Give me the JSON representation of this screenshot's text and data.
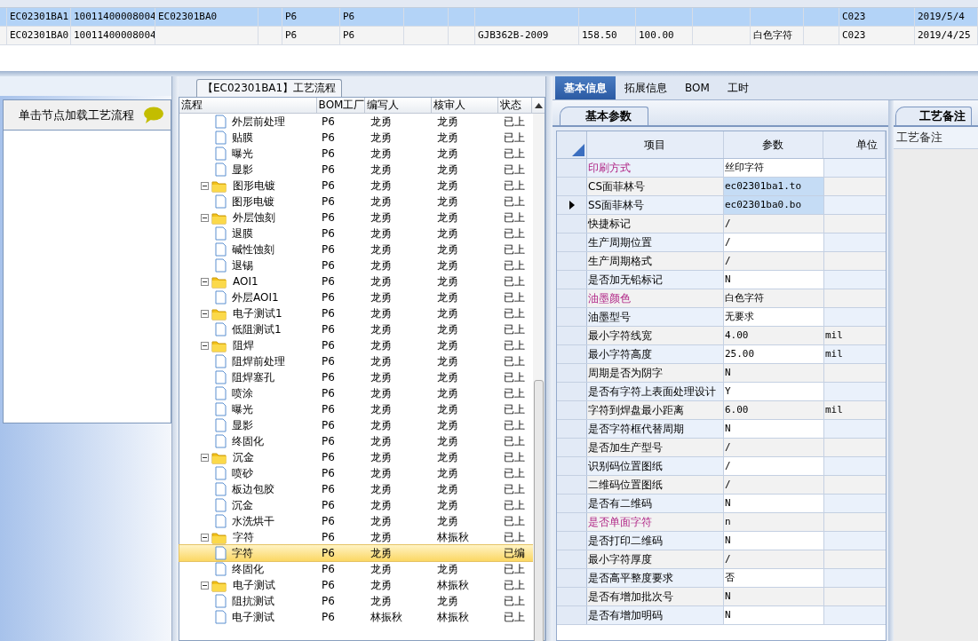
{
  "top_table": {
    "rows": [
      {
        "selected": true,
        "column_1": "EC02301BA1",
        "column_2": "10011400008004",
        "column_3": "EC02301BA0",
        "column_5": "P6",
        "column_6": "P6",
        "column_15": "C023",
        "column_16": "2019/5/4"
      },
      {
        "selected": false,
        "column_1": "EC02301BA0",
        "column_2": "10011400008004",
        "column_5": "P6",
        "column_6": "P6",
        "column_9": "GJB362B-2009",
        "column_10": "158.50",
        "column_11": "100.00",
        "column_13": "白色字符",
        "column_15": "C023",
        "column_16": "2019/4/25"
      }
    ]
  },
  "left_panel": {
    "hint": "单击节点加载工艺流程"
  },
  "flow_panel": {
    "title": "【EC02301BA1】工艺流程",
    "columns": [
      "流程",
      "BOM工厂",
      "编写人",
      "核审人",
      "状态"
    ],
    "tree": [
      {
        "children": [
          {
            "name": "外层前处理",
            "bom": "P6",
            "writer": "龙勇",
            "reviewer": "龙勇",
            "status": "已上",
            "selected": false
          },
          {
            "name": "贴膜",
            "bom": "P6",
            "writer": "龙勇",
            "reviewer": "龙勇",
            "status": "已上",
            "selected": false
          },
          {
            "name": "曝光",
            "bom": "P6",
            "writer": "龙勇",
            "reviewer": "龙勇",
            "status": "已上",
            "selected": false
          },
          {
            "name": "显影",
            "bom": "P6",
            "writer": "龙勇",
            "reviewer": "龙勇",
            "status": "已上",
            "selected": false
          }
        ]
      },
      {
        "name": "图形电镀",
        "bom": "P6",
        "writer": "龙勇",
        "reviewer": "龙勇",
        "status": "已上",
        "selected": false,
        "expanded": true,
        "children": [
          {
            "name": "图形电镀",
            "bom": "P6",
            "writer": "龙勇",
            "reviewer": "龙勇",
            "status": "已上",
            "selected": false
          }
        ]
      },
      {
        "name": "外层蚀刻",
        "bom": "P6",
        "writer": "龙勇",
        "reviewer": "龙勇",
        "status": "已上",
        "selected": false,
        "expanded": true,
        "children": [
          {
            "name": "退膜",
            "bom": "P6",
            "writer": "龙勇",
            "reviewer": "龙勇",
            "status": "已上",
            "selected": false
          },
          {
            "name": "碱性蚀刻",
            "bom": "P6",
            "writer": "龙勇",
            "reviewer": "龙勇",
            "status": "已上",
            "selected": false
          },
          {
            "name": "退锡",
            "bom": "P6",
            "writer": "龙勇",
            "reviewer": "龙勇",
            "status": "已上",
            "selected": false
          }
        ]
      },
      {
        "name": "AOI1",
        "bom": "P6",
        "writer": "龙勇",
        "reviewer": "龙勇",
        "status": "已上",
        "selected": false,
        "expanded": true,
        "children": [
          {
            "name": "外层AOI1",
            "bom": "P6",
            "writer": "龙勇",
            "reviewer": "龙勇",
            "status": "已上",
            "selected": false
          }
        ]
      },
      {
        "name": "电子测试1",
        "bom": "P6",
        "writer": "龙勇",
        "reviewer": "龙勇",
        "status": "已上",
        "selected": false,
        "expanded": true,
        "children": [
          {
            "name": "低阻测试1",
            "bom": "P6",
            "writer": "龙勇",
            "reviewer": "龙勇",
            "status": "已上",
            "selected": false
          }
        ]
      },
      {
        "name": "阻焊",
        "bom": "P6",
        "writer": "龙勇",
        "reviewer": "龙勇",
        "status": "已上",
        "selected": false,
        "expanded": true,
        "children": [
          {
            "name": "阻焊前处理",
            "bom": "P6",
            "writer": "龙勇",
            "reviewer": "龙勇",
            "status": "已上",
            "selected": false
          },
          {
            "name": "阻焊塞孔",
            "bom": "P6",
            "writer": "龙勇",
            "reviewer": "龙勇",
            "status": "已上",
            "selected": false
          },
          {
            "name": "喷涂",
            "bom": "P6",
            "writer": "龙勇",
            "reviewer": "龙勇",
            "status": "已上",
            "selected": false
          },
          {
            "name": "曝光",
            "bom": "P6",
            "writer": "龙勇",
            "reviewer": "龙勇",
            "status": "已上",
            "selected": false
          },
          {
            "name": "显影",
            "bom": "P6",
            "writer": "龙勇",
            "reviewer": "龙勇",
            "status": "已上",
            "selected": false
          },
          {
            "name": "终固化",
            "bom": "P6",
            "writer": "龙勇",
            "reviewer": "龙勇",
            "status": "已上",
            "selected": false
          }
        ]
      },
      {
        "name": "沉金",
        "bom": "P6",
        "writer": "龙勇",
        "reviewer": "龙勇",
        "status": "已上",
        "selected": false,
        "expanded": true,
        "children": [
          {
            "name": "喷砂",
            "bom": "P6",
            "writer": "龙勇",
            "reviewer": "龙勇",
            "status": "已上",
            "selected": false
          },
          {
            "name": "板边包胶",
            "bom": "P6",
            "writer": "龙勇",
            "reviewer": "龙勇",
            "status": "已上",
            "selected": false
          },
          {
            "name": "沉金",
            "bom": "P6",
            "writer": "龙勇",
            "reviewer": "龙勇",
            "status": "已上",
            "selected": false
          },
          {
            "name": "水洗烘干",
            "bom": "P6",
            "writer": "龙勇",
            "reviewer": "龙勇",
            "status": "已上",
            "selected": false
          }
        ]
      },
      {
        "name": "字符",
        "bom": "P6",
        "writer": "龙勇",
        "reviewer": "林振秋",
        "status": "已上",
        "selected": false,
        "expanded": true,
        "children": [
          {
            "name": "字符",
            "bom": "P6",
            "writer": "龙勇",
            "status": "已编",
            "selected": true
          },
          {
            "name": "终固化",
            "bom": "P6",
            "writer": "龙勇",
            "reviewer": "龙勇",
            "status": "已上",
            "selected": false
          }
        ]
      },
      {
        "name": "电子测试",
        "bom": "P6",
        "writer": "龙勇",
        "reviewer": "林振秋",
        "status": "已上",
        "selected": false,
        "expanded": true,
        "children": [
          {
            "name": "阻抗测试",
            "bom": "P6",
            "writer": "龙勇",
            "reviewer": "龙勇",
            "status": "已上",
            "selected": false
          },
          {
            "name": "电子测试",
            "bom": "P6",
            "writer": "林振秋",
            "reviewer": "林振秋",
            "status": "已上",
            "selected": false
          }
        ]
      }
    ]
  },
  "info_panel": {
    "tabs": [
      {
        "label": "基本信息",
        "selected": true
      },
      {
        "label": "拓展信息",
        "selected": false
      },
      {
        "label": "BOM",
        "selected": false
      },
      {
        "label": "工时",
        "selected": false
      }
    ],
    "sub_tab": "基本参数",
    "columns": [
      "项目",
      "参数",
      "单位"
    ],
    "rows": [
      {
        "item": "印刷方式",
        "value": "丝印字符",
        "flagged": true,
        "selected": false,
        "current": false
      },
      {
        "item": "CS面菲林号",
        "value": "ec02301ba1.to",
        "flagged": false,
        "selected": true,
        "current": false
      },
      {
        "item": "SS面菲林号",
        "value": "ec02301ba0.bo",
        "flagged": false,
        "selected": true,
        "current": true
      },
      {
        "item": "快捷标记",
        "value": "/",
        "flagged": false,
        "selected": false,
        "current": false
      },
      {
        "item": "生产周期位置",
        "value": "/",
        "flagged": false,
        "selected": false,
        "current": false
      },
      {
        "item": "生产周期格式",
        "value": "/",
        "flagged": false,
        "selected": false,
        "current": false
      },
      {
        "item": "是否加无铅标记",
        "value": "N",
        "flagged": false,
        "selected": false,
        "current": false
      },
      {
        "item": "油墨颜色",
        "value": "白色字符",
        "flagged": true,
        "selected": false,
        "current": false
      },
      {
        "item": "油墨型号",
        "value": "无要求",
        "flagged": false,
        "selected": false,
        "current": false
      },
      {
        "item": "最小字符线宽",
        "value": "4.00",
        "unit": "mil",
        "flagged": false,
        "selected": false,
        "current": false
      },
      {
        "item": "最小字符高度",
        "value": "25.00",
        "unit": "mil",
        "flagged": false,
        "selected": false,
        "current": false
      },
      {
        "item": "周期是否为阴字",
        "value": "N",
        "flagged": false,
        "selected": false,
        "current": false
      },
      {
        "item": "是否有字符上表面处理设计",
        "value": "Y",
        "flagged": false,
        "selected": false,
        "current": false
      },
      {
        "item": "字符到焊盘最小距离",
        "value": "6.00",
        "unit": "mil",
        "flagged": false,
        "selected": false,
        "current": false
      },
      {
        "item": "是否字符框代替周期",
        "value": "N",
        "flagged": false,
        "selected": false,
        "current": false
      },
      {
        "item": "是否加生产型号",
        "value": "/",
        "flagged": false,
        "selected": false,
        "current": false
      },
      {
        "item": "识别码位置图纸",
        "value": "/",
        "flagged": false,
        "selected": false,
        "current": false
      },
      {
        "item": "二维码位置图纸",
        "value": "/",
        "flagged": false,
        "selected": false,
        "current": false
      },
      {
        "item": "是否有二维码",
        "value": "N",
        "flagged": false,
        "selected": false,
        "current": false
      },
      {
        "item": "是否单面字符",
        "value": "n",
        "flagged": true,
        "selected": false,
        "current": false
      },
      {
        "item": "是否打印二维码",
        "value": "N",
        "flagged": false,
        "selected": false,
        "current": false
      },
      {
        "item": "最小字符厚度",
        "value": "/",
        "flagged": false,
        "selected": false,
        "current": false
      },
      {
        "item": "是否高平整度要求",
        "value": "否",
        "flagged": false,
        "selected": false,
        "current": false
      },
      {
        "item": "是否有增加批次号",
        "value": "N",
        "flagged": false,
        "selected": false,
        "current": false
      },
      {
        "item": "是否有增加明码",
        "value": "N",
        "flagged": false,
        "selected": false,
        "current": false
      }
    ]
  },
  "notes_panel": {
    "title": "工艺备注",
    "label": "工艺备注"
  }
}
